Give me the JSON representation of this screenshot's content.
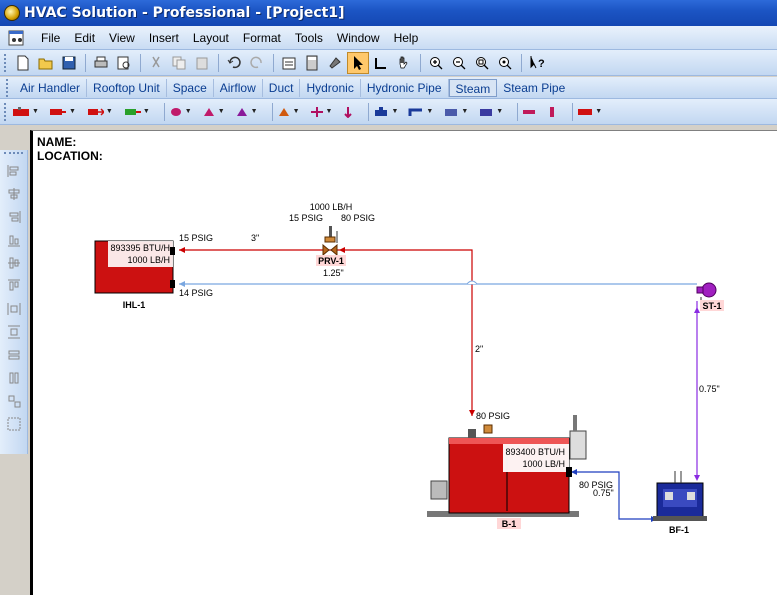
{
  "window": {
    "title": "HVAC Solution - Professional - [Project1]"
  },
  "menu": [
    "File",
    "Edit",
    "View",
    "Insert",
    "Layout",
    "Format",
    "Tools",
    "Window",
    "Help"
  ],
  "tabs": [
    {
      "label": "Air Handler",
      "active": false
    },
    {
      "label": "Rooftop Unit",
      "active": false
    },
    {
      "label": "Space",
      "active": false
    },
    {
      "label": "Airflow",
      "active": false
    },
    {
      "label": "Duct",
      "active": false
    },
    {
      "label": "Hydronic",
      "active": false
    },
    {
      "label": "Hydronic Pipe",
      "active": false
    },
    {
      "label": "Steam",
      "active": true
    },
    {
      "label": "Steam Pipe",
      "active": false
    }
  ],
  "header": {
    "name_label": "NAME:",
    "location_label": "LOCATION:"
  },
  "diagram": {
    "ihl": {
      "id": "IHL-1",
      "load_btu": "893395 BTU/H",
      "load_lb": "1000 LB/H",
      "in_pressure": "15 PSIG",
      "out_pressure": "14 PSIG"
    },
    "prv": {
      "id": "PRV-1",
      "flow": "1000 LB/H",
      "in_pressure": "80 PSIG",
      "out_pressure": "15 PSIG"
    },
    "pipes": {
      "supply_size": "3\"",
      "return_size": "1.25\"",
      "riser_size": "2\"",
      "trap_size": "0.75\"",
      "feed_size": "0.75\""
    },
    "trap": {
      "id": "ST-1"
    },
    "boiler": {
      "id": "B-1",
      "output_btu": "893400 BTU/H",
      "output_lb": "1000 LB/H",
      "steam_pressure": "80 PSIG",
      "feed_pressure": "80 PSIG"
    },
    "feed": {
      "id": "BF-1"
    }
  },
  "colors": {
    "supply": "#cc0000",
    "return": "#7aa7e0",
    "trap_line": "#8a2be2",
    "feed_line": "#1f3fbf",
    "equipment": "#cc1111"
  }
}
